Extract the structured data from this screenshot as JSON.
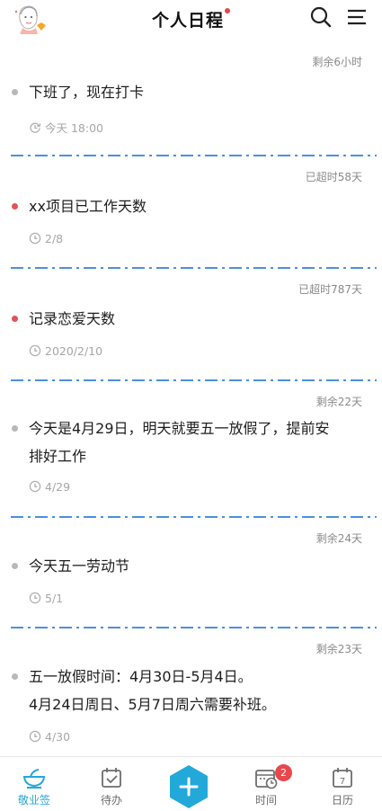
{
  "header": {
    "title": "个人日程",
    "accent_color": "#e2494b"
  },
  "schedule": [
    {
      "status": "剩余6小时",
      "title_lines": [
        "下班了，现在打卡"
      ],
      "meta_icon": "repeat-alarm-icon",
      "meta_text": "今天 18:00",
      "dot_color": "gray"
    },
    {
      "status": "已超时58天",
      "title_lines": [
        "xx项目已工作天数"
      ],
      "meta_icon": "clock-icon",
      "meta_text": "2/8",
      "dot_color": "red"
    },
    {
      "status": "已超时787天",
      "title_lines": [
        "记录恋爱天数"
      ],
      "meta_icon": "clock-icon",
      "meta_text": "2020/2/10",
      "dot_color": "red"
    },
    {
      "status": "剩余22天",
      "title_lines": [
        "今天是4月29日，明天就要五一放假了，提前安",
        "排好工作"
      ],
      "meta_icon": "clock-icon",
      "meta_text": "4/29",
      "dot_color": "gray"
    },
    {
      "status": "剩余24天",
      "title_lines": [
        "今天五一劳动节"
      ],
      "meta_icon": "clock-icon",
      "meta_text": "5/1",
      "dot_color": "gray"
    },
    {
      "status": "剩余23天",
      "title_lines": [
        "五一放假时间：4月30日-5月4日。",
        "4月24日周日、5月7日周六需要补班。"
      ],
      "meta_icon": "clock-icon",
      "meta_text": "4/30",
      "dot_color": "gray"
    }
  ],
  "tabbar": {
    "tabs": [
      {
        "label": "敬业签",
        "icon": "bowl-icon",
        "active": true
      },
      {
        "label": "待办",
        "icon": "todo-check-icon",
        "active": false
      },
      {
        "label": "",
        "icon": "add-hexagon-icon",
        "active": false
      },
      {
        "label": "时间",
        "icon": "calendar-clock-icon",
        "active": false,
        "badge": "2"
      },
      {
        "label": "日历",
        "icon": "calendar-icon",
        "active": false,
        "day": "7"
      }
    ],
    "active_color": "#25a8d6"
  }
}
